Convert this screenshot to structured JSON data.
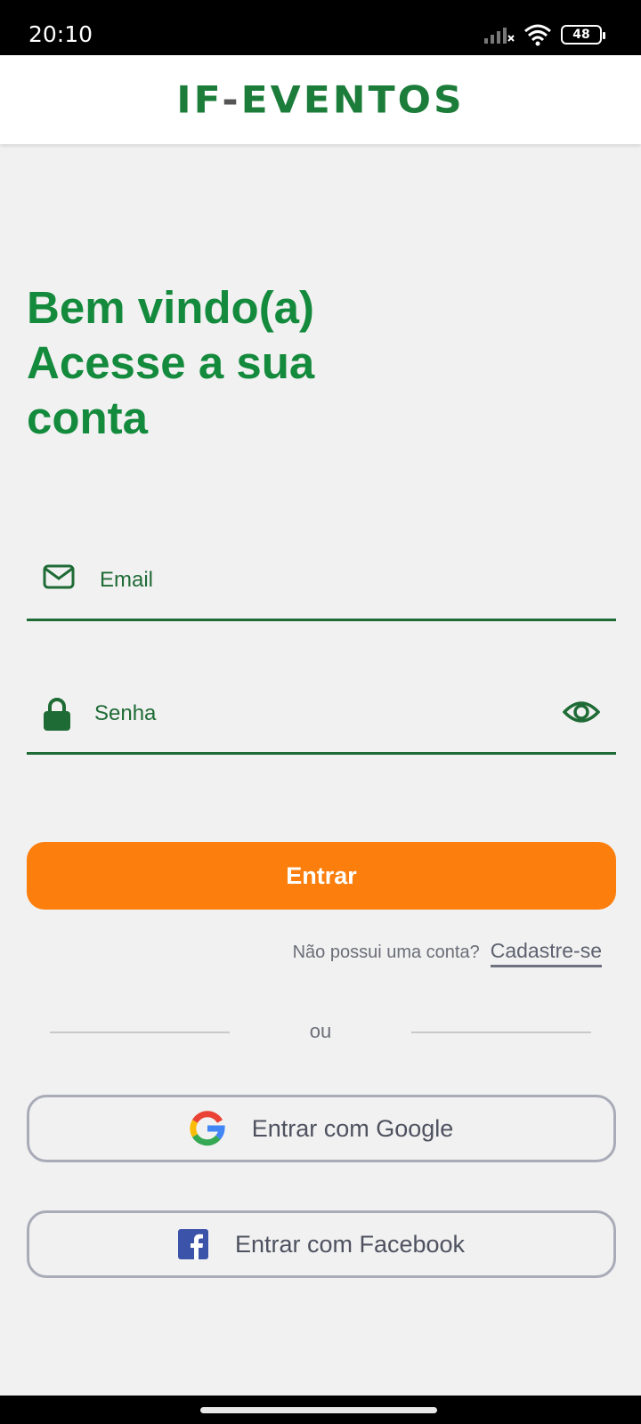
{
  "status_bar": {
    "time": "20:10",
    "battery": "48",
    "icons": [
      "signal-icon",
      "wifi-icon",
      "battery-icon"
    ]
  },
  "header": {
    "logo_left": "IF",
    "logo_dash": "-",
    "logo_right": "EVENTOS"
  },
  "welcome": {
    "line1": "Bem vindo(a)",
    "line2": "Acesse a sua",
    "line3": "conta"
  },
  "form": {
    "email_placeholder": "Email",
    "password_placeholder": "Senha",
    "submit_label": "Entrar"
  },
  "signup": {
    "prompt": "Não possui uma conta?",
    "link": "Cadastre-se"
  },
  "divider": {
    "text": "ou"
  },
  "social": {
    "google_label": "Entrar com Google",
    "facebook_label": "Entrar com Facebook"
  },
  "colors": {
    "primary_green": "#148a3d",
    "field_green": "#1f6b35",
    "accent_orange": "#fc7e0c",
    "background": "#f1f1f1"
  }
}
